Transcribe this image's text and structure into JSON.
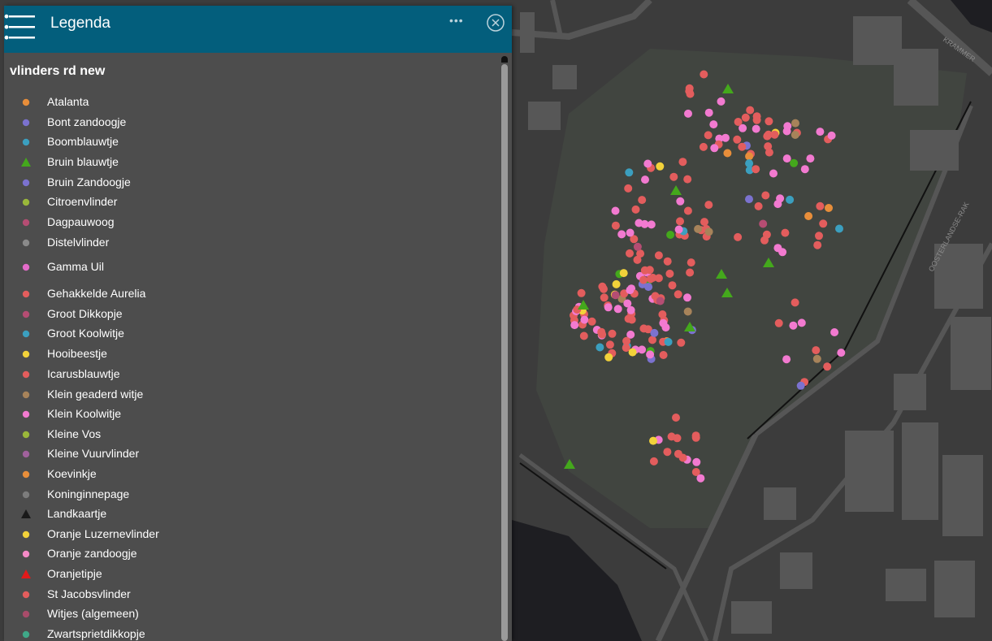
{
  "legend": {
    "title": "Legenda",
    "layer_title": "vlinders rd new",
    "items": [
      {
        "label": "Atalanta",
        "color": "#e88e3a",
        "shape": "circle"
      },
      {
        "label": "Bont zandoogje",
        "color": "#7b72cf",
        "shape": "circle"
      },
      {
        "label": "Boomblauwtje",
        "color": "#3b9fbf",
        "shape": "circle"
      },
      {
        "label": "Bruin blauwtje",
        "color": "#44a81c",
        "shape": "triangle"
      },
      {
        "label": "Bruin Zandoogje",
        "color": "#7b72cf",
        "shape": "circle"
      },
      {
        "label": "Citroenvlinder",
        "color": "#9ab83a",
        "shape": "circle"
      },
      {
        "label": "Dagpauwoog",
        "color": "#b54d73",
        "shape": "circle"
      },
      {
        "label": "Distelvlinder",
        "color": "#8a8a8a",
        "shape": "circle"
      },
      {
        "label": "Gamma Uil",
        "color": "#e36bc9",
        "shape": "circle"
      },
      {
        "label": "Gehakkelde Aurelia",
        "color": "#e35d5d",
        "shape": "circle"
      },
      {
        "label": "Groot Dikkopje",
        "color": "#b54d73",
        "shape": "circle"
      },
      {
        "label": "Groot Koolwitje",
        "color": "#3b9fbf",
        "shape": "circle"
      },
      {
        "label": "Hooibeestje",
        "color": "#f2d23a",
        "shape": "circle"
      },
      {
        "label": "Icarusblauwtje",
        "color": "#e35d5d",
        "shape": "circle"
      },
      {
        "label": "Klein geaderd witje",
        "color": "#a7835a",
        "shape": "circle"
      },
      {
        "label": "Klein Koolwitje",
        "color": "#f27ad0",
        "shape": "circle"
      },
      {
        "label": "Kleine Vos",
        "color": "#9ab83a",
        "shape": "circle"
      },
      {
        "label": "Kleine Vuurvlinder",
        "color": "#a0619c",
        "shape": "circle"
      },
      {
        "label": "Koevinkje",
        "color": "#e88e3a",
        "shape": "circle"
      },
      {
        "label": "Koninginnepage",
        "color": "#7c7c7c",
        "shape": "circle"
      },
      {
        "label": "Landkaartje",
        "color": "#1a1a1a",
        "shape": "triangle"
      },
      {
        "label": "Oranje Luzernevlinder",
        "color": "#f2d23a",
        "shape": "circle"
      },
      {
        "label": "Oranje zandoogje",
        "color": "#f58ac7",
        "shape": "circle"
      },
      {
        "label": "Oranjetipje",
        "color": "#e21a1a",
        "shape": "triangle"
      },
      {
        "label": "St Jacobsvlinder",
        "color": "#e35d5d",
        "shape": "circle"
      },
      {
        "label": "Witjes (algemeen)",
        "color": "#a84c6a",
        "shape": "circle"
      },
      {
        "label": "Zwartsprietdikkopje",
        "color": "#3fa888",
        "shape": "circle"
      }
    ]
  },
  "map": {
    "street_labels": [
      "KRAMMER",
      "OOSTERLANDSE-RAK"
    ],
    "observation_colors": [
      "#e35d5d",
      "#f27ad0",
      "#7b72cf",
      "#3b9fbf",
      "#e88e3a",
      "#44a81c",
      "#f2d23a",
      "#a7835a",
      "#b54d73"
    ]
  }
}
